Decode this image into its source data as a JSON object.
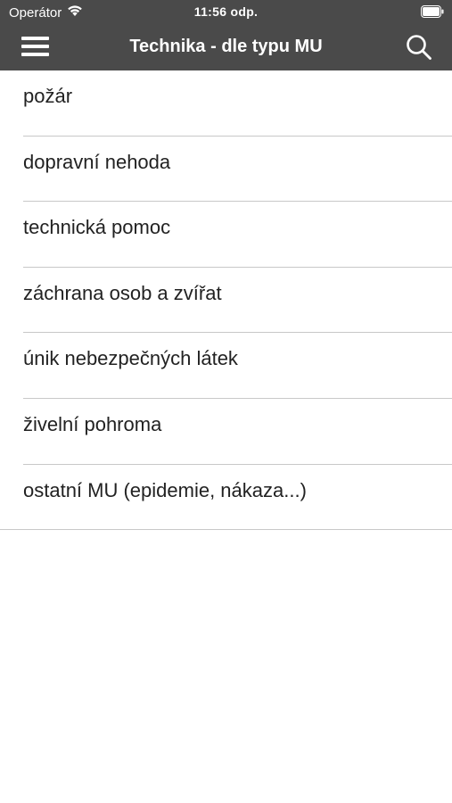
{
  "status_bar": {
    "carrier": "Operátor",
    "time": "11:56 odp.",
    "wifi_icon": "wifi-icon",
    "battery_icon": "battery-icon",
    "battery_level": 1.0
  },
  "nav_bar": {
    "title": "Technika - dle typu MU",
    "menu_icon": "hamburger-menu-icon",
    "search_icon": "search-icon",
    "background_color": "#4a4a4a"
  },
  "list": {
    "items": [
      {
        "label": "požár"
      },
      {
        "label": "dopravní nehoda"
      },
      {
        "label": "technická pomoc"
      },
      {
        "label": "záchrana osob a zvířat"
      },
      {
        "label": "únik nebezpečných látek"
      },
      {
        "label": "živelní pohroma"
      },
      {
        "label": "ostatní MU (epidemie, nákaza...)"
      }
    ]
  }
}
